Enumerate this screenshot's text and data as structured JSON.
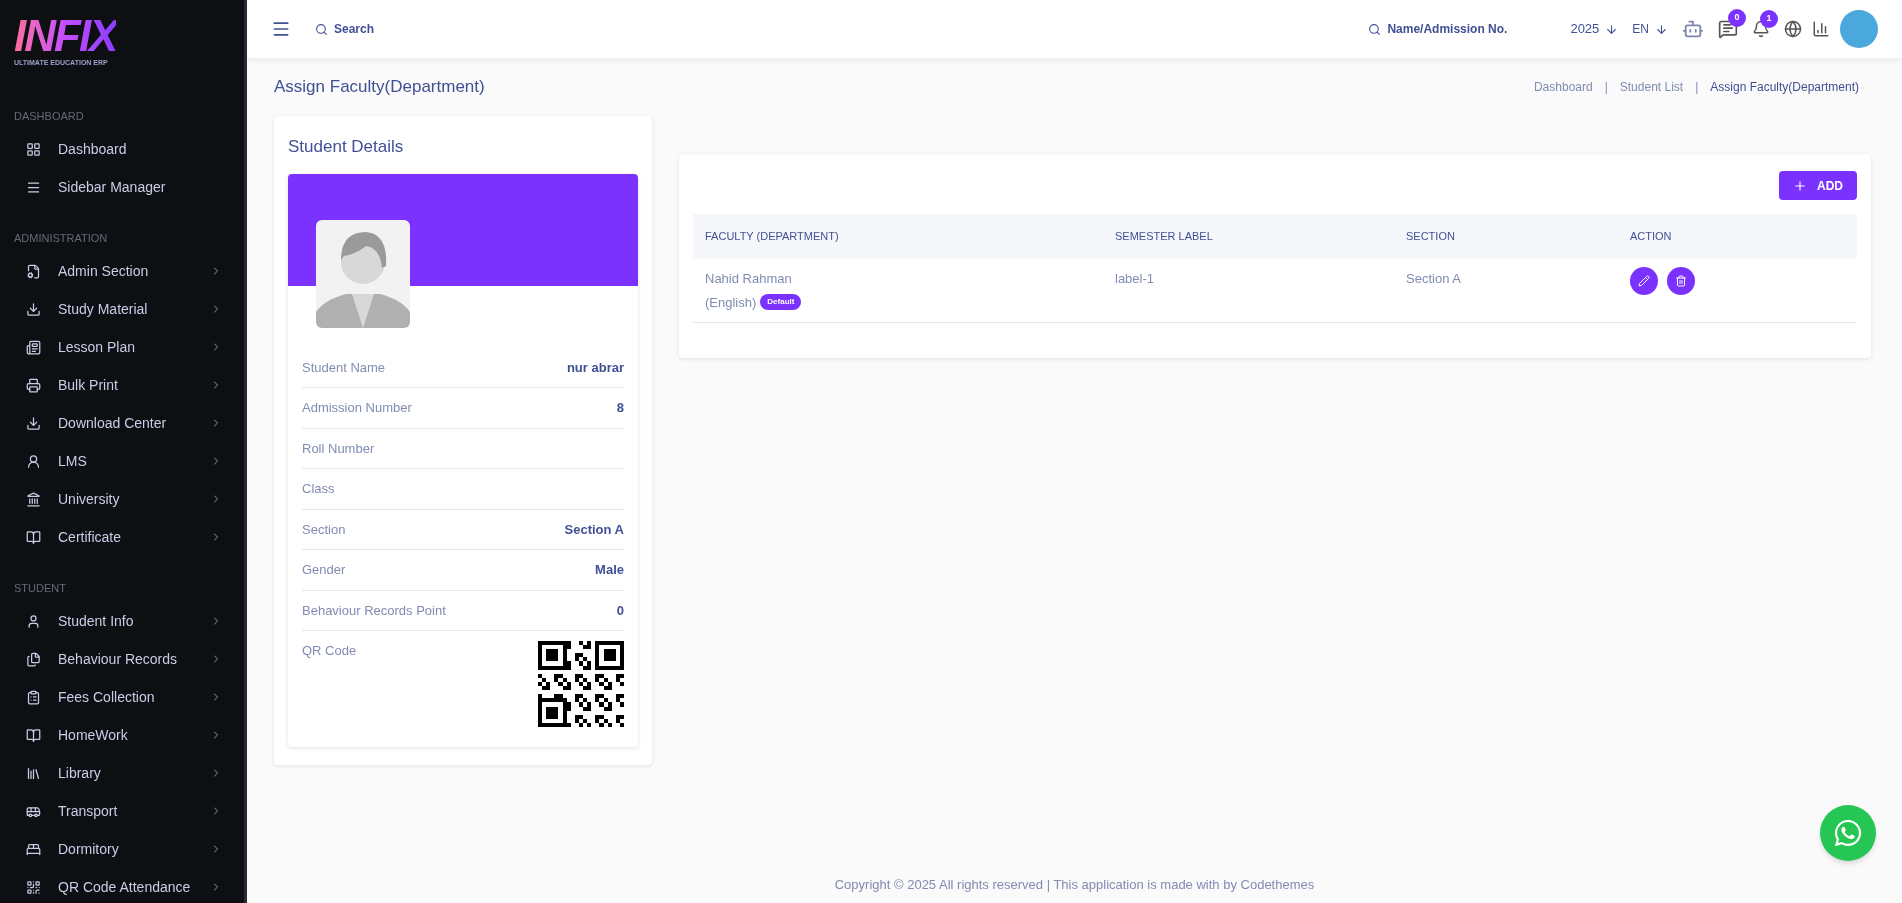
{
  "logo": {
    "text": "INFIX",
    "tagline": "ULTIMATE EDUCATION ERP"
  },
  "sidebar": {
    "sections": [
      {
        "heading": "DASHBOARD",
        "items": [
          {
            "label": "Dashboard",
            "has_submenu": false
          },
          {
            "label": "Sidebar Manager",
            "has_submenu": false
          }
        ]
      },
      {
        "heading": "ADMINISTRATION",
        "items": [
          {
            "label": "Admin Section",
            "has_submenu": true
          },
          {
            "label": "Study Material",
            "has_submenu": true
          },
          {
            "label": "Lesson Plan",
            "has_submenu": true
          },
          {
            "label": "Bulk Print",
            "has_submenu": true
          },
          {
            "label": "Download Center",
            "has_submenu": true
          },
          {
            "label": "LMS",
            "has_submenu": true
          },
          {
            "label": "University",
            "has_submenu": true
          },
          {
            "label": "Certificate",
            "has_submenu": true
          }
        ]
      },
      {
        "heading": "STUDENT",
        "items": [
          {
            "label": "Student Info",
            "has_submenu": true
          },
          {
            "label": "Behaviour Records",
            "has_submenu": true
          },
          {
            "label": "Fees Collection",
            "has_submenu": true
          },
          {
            "label": "HomeWork",
            "has_submenu": true
          },
          {
            "label": "Library",
            "has_submenu": true
          },
          {
            "label": "Transport",
            "has_submenu": true
          },
          {
            "label": "Dormitory",
            "has_submenu": true
          },
          {
            "label": "QR Code Attendance",
            "has_submenu": true
          }
        ]
      }
    ]
  },
  "topbar": {
    "search": {
      "placeholder": "Search"
    },
    "student_search": {
      "placeholder": "Name/Admission No."
    },
    "year": "2025",
    "language": "EN",
    "messages_count": "0",
    "notifications_count": "1"
  },
  "page": {
    "title": "Assign Faculty(Department)",
    "breadcrumbs": [
      {
        "kind": "link",
        "label": "Dashboard",
        "selected": false
      },
      {
        "kind": "separator",
        "label": "|"
      },
      {
        "kind": "link",
        "label": "Student List",
        "selected": false
      },
      {
        "kind": "separator",
        "label": "|"
      },
      {
        "kind": "link",
        "label": "Assign Faculty(Department)",
        "selected": true
      }
    ]
  },
  "student_details": {
    "title": "Student Details",
    "fields": [
      {
        "label": "Student Name",
        "value": "nur abrar"
      },
      {
        "label": "Admission Number",
        "value": "8"
      },
      {
        "label": "Roll Number"
      },
      {
        "label": "Class"
      },
      {
        "label": "Section",
        "value": "Section A"
      },
      {
        "label": "Gender",
        "value": "Male"
      },
      {
        "label": "Behaviour Records Point",
        "value": "0"
      },
      {
        "label": "QR Code",
        "kind": "qr"
      }
    ]
  },
  "table": {
    "add_button": "ADD",
    "columns": [
      "FACULTY (DEPARTMENT)",
      "SEMESTER LABEL",
      "SECTION",
      "ACTION"
    ],
    "rows": [
      {
        "faculty": "Nahid Rahman",
        "department": "(English)",
        "badge": "Default",
        "semester_label": "label-1",
        "section": "Section A"
      }
    ]
  },
  "footer": "Copyright © 2025 All rights reserved | This application is made with by Codethemes"
}
